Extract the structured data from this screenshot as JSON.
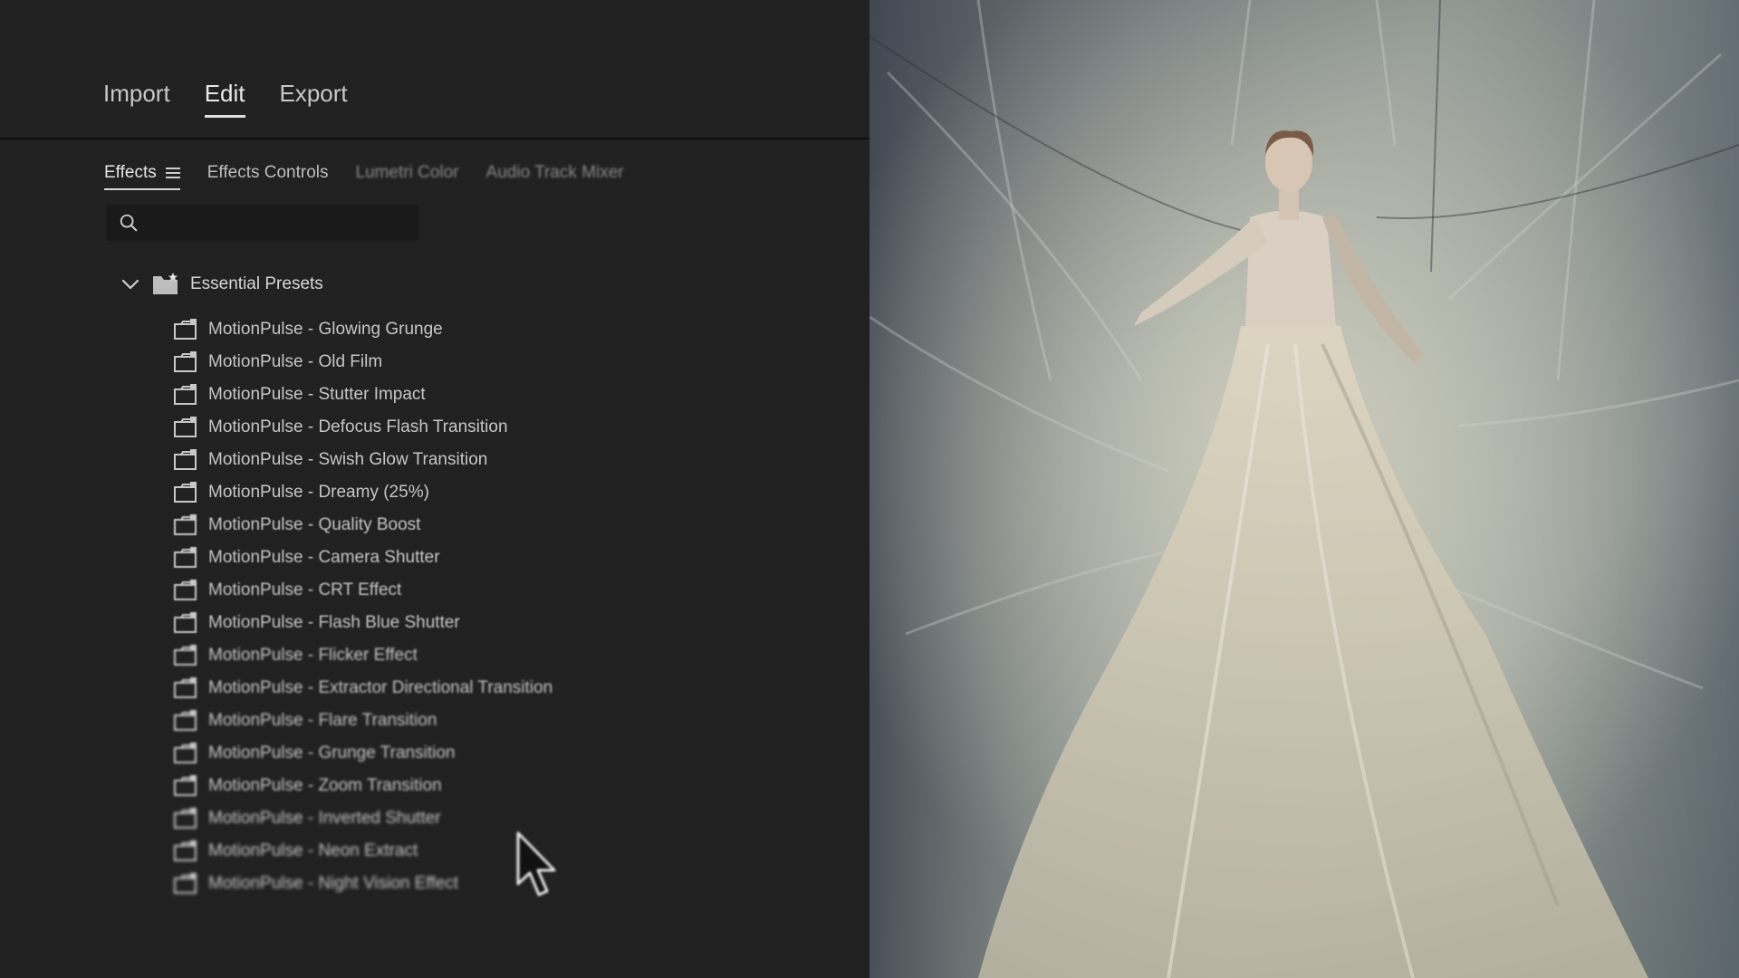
{
  "workspace_tabs": [
    {
      "label": "Import"
    },
    {
      "label": "Edit",
      "active": true
    },
    {
      "label": "Export"
    }
  ],
  "panel_tabs": [
    {
      "label": "Effects",
      "active": true
    },
    {
      "label": "Effects Controls"
    },
    {
      "label": "Lumetri Color"
    },
    {
      "label": "Audio Track Mixer"
    }
  ],
  "search": {
    "value": "",
    "placeholder": ""
  },
  "tree": {
    "root_label": "Essential Presets",
    "expanded": true,
    "items": [
      "MotionPulse - Glowing Grunge",
      "MotionPulse - Old Film",
      "MotionPulse - Stutter Impact",
      "MotionPulse - Defocus Flash Transition",
      "MotionPulse - Swish Glow Transition",
      "MotionPulse - Dreamy (25%)",
      "MotionPulse - Quality Boost",
      "MotionPulse - Camera Shutter",
      "MotionPulse - CRT Effect",
      "MotionPulse - Flash Blue Shutter",
      "MotionPulse - Flicker Effect",
      "MotionPulse - Extractor Directional Transition",
      "MotionPulse - Flare Transition",
      "MotionPulse - Grunge Transition",
      "MotionPulse - Zoom Transition",
      "MotionPulse - Inverted Shutter",
      "MotionPulse - Neon Extract",
      "MotionPulse - Night Vision Effect"
    ]
  },
  "preview": {
    "subject": "woman in white gown with draped fabric backdrop"
  },
  "icons": {
    "search": "search-icon",
    "menu": "hamburger-menu-icon",
    "chevron": "chevron-down-icon",
    "folder": "folder-star-icon",
    "preset": "preset-bin-icon",
    "cursor": "mouse-cursor-icon"
  },
  "colors": {
    "panel_bg": "#212121",
    "text_primary": "#e6e6e6",
    "text_secondary": "#c6c6c6"
  }
}
